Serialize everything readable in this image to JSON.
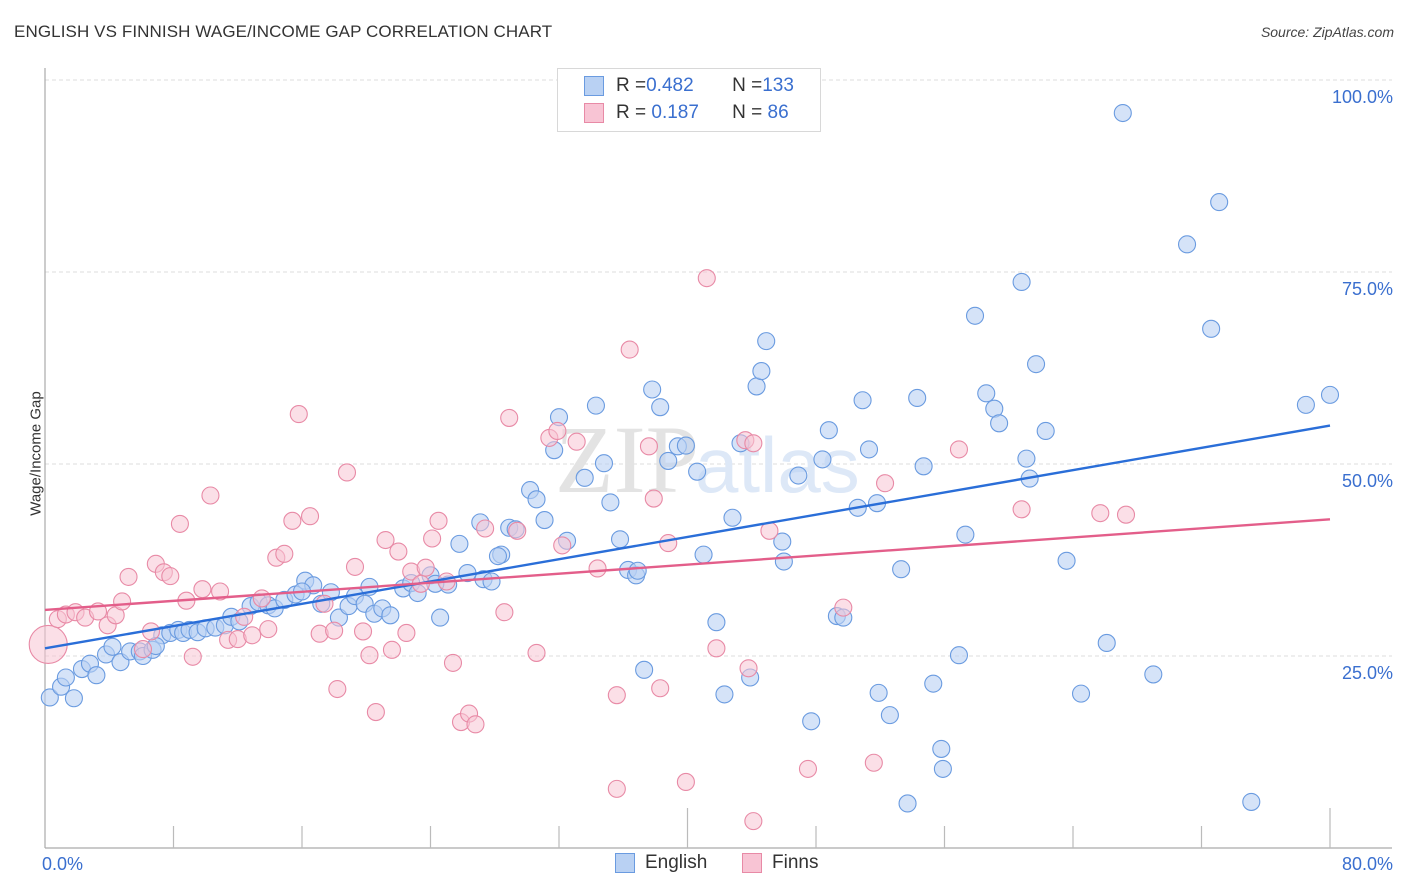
{
  "title": "ENGLISH VS FINNISH WAGE/INCOME GAP CORRELATION CHART",
  "source": "Source: ZipAtlas.com",
  "watermark": {
    "zip": "ZIP",
    "atlas": "atlas"
  },
  "legend": {
    "rows": [
      {
        "r_label": "R = ",
        "r_value": "0.482",
        "n_label": "N = ",
        "n_value": "133"
      },
      {
        "r_label": "R = ",
        "r_value": " 0.187",
        "n_label": "N = ",
        "n_value": " 86"
      }
    ]
  },
  "chart_data": {
    "type": "scatter",
    "title": "ENGLISH VS FINNISH WAGE/INCOME GAP CORRELATION CHART",
    "xlabel": "",
    "ylabel": "Wage/Income Gap",
    "xlim": [
      0,
      80
    ],
    "ylim": [
      0,
      100
    ],
    "x_ticks": [
      "0.0%",
      "80.0%"
    ],
    "y_ticks": [
      "25.0%",
      "50.0%",
      "75.0%",
      "100.0%"
    ],
    "grid": true,
    "legend_position": "bottom-center",
    "series": [
      {
        "name": "English",
        "color": "#6a9be0",
        "fill": "#b9d1f3",
        "R": 0.482,
        "N": 133,
        "trend": {
          "x": [
            0,
            80
          ],
          "y": [
            26.0,
            55.0
          ],
          "color": "#2a6ed8"
        },
        "points": [
          [
            0.3,
            19.6
          ],
          [
            1.0,
            21.0
          ],
          [
            1.3,
            22.2
          ],
          [
            1.8,
            19.5
          ],
          [
            2.3,
            23.3
          ],
          [
            2.8,
            24.0
          ],
          [
            3.2,
            22.5
          ],
          [
            3.8,
            25.2
          ],
          [
            4.2,
            26.2
          ],
          [
            4.7,
            24.2
          ],
          [
            5.3,
            25.6
          ],
          [
            5.9,
            25.6
          ],
          [
            6.1,
            25.0
          ],
          [
            6.7,
            25.8
          ],
          [
            7.3,
            27.7
          ],
          [
            7.8,
            28.0
          ],
          [
            8.3,
            28.4
          ],
          [
            8.6,
            28.0
          ],
          [
            9.0,
            28.4
          ],
          [
            9.5,
            28.1
          ],
          [
            10.0,
            28.6
          ],
          [
            10.6,
            28.7
          ],
          [
            11.2,
            29.0
          ],
          [
            11.6,
            30.1
          ],
          [
            12.1,
            29.5
          ],
          [
            12.8,
            31.5
          ],
          [
            13.3,
            32.0
          ],
          [
            13.9,
            31.6
          ],
          [
            14.3,
            31.2
          ],
          [
            14.9,
            32.3
          ],
          [
            15.6,
            33.0
          ],
          [
            16.2,
            34.8
          ],
          [
            16.7,
            34.2
          ],
          [
            17.2,
            31.8
          ],
          [
            17.8,
            33.3
          ],
          [
            18.3,
            30.0
          ],
          [
            18.9,
            31.5
          ],
          [
            19.3,
            32.8
          ],
          [
            19.9,
            31.8
          ],
          [
            20.5,
            30.5
          ],
          [
            21.0,
            31.2
          ],
          [
            21.5,
            30.3
          ],
          [
            22.3,
            33.8
          ],
          [
            22.8,
            34.5
          ],
          [
            23.2,
            33.2
          ],
          [
            24.0,
            35.5
          ],
          [
            24.6,
            30.0
          ],
          [
            25.1,
            34.3
          ],
          [
            25.8,
            39.6
          ],
          [
            26.3,
            35.8
          ],
          [
            27.1,
            42.4
          ],
          [
            27.3,
            35.0
          ],
          [
            27.8,
            34.7
          ],
          [
            28.4,
            38.2
          ],
          [
            28.9,
            41.7
          ],
          [
            29.3,
            41.5
          ],
          [
            30.2,
            46.6
          ],
          [
            30.6,
            45.4
          ],
          [
            31.1,
            42.7
          ],
          [
            31.7,
            51.8
          ],
          [
            32.0,
            56.1
          ],
          [
            32.5,
            40.0
          ],
          [
            33.6,
            48.2
          ],
          [
            34.3,
            57.6
          ],
          [
            34.8,
            50.1
          ],
          [
            35.2,
            45.0
          ],
          [
            35.8,
            40.2
          ],
          [
            36.3,
            36.2
          ],
          [
            36.8,
            35.5
          ],
          [
            37.3,
            23.2
          ],
          [
            37.8,
            59.7
          ],
          [
            38.3,
            57.4
          ],
          [
            38.8,
            50.4
          ],
          [
            39.4,
            52.3
          ],
          [
            39.9,
            52.4
          ],
          [
            40.6,
            49.0
          ],
          [
            41.0,
            38.2
          ],
          [
            41.8,
            29.4
          ],
          [
            42.3,
            20.0
          ],
          [
            42.8,
            43.0
          ],
          [
            43.3,
            52.7
          ],
          [
            43.9,
            22.2
          ],
          [
            44.3,
            60.1
          ],
          [
            44.6,
            62.1
          ],
          [
            44.9,
            66.0
          ],
          [
            45.9,
            39.9
          ],
          [
            46.0,
            37.3
          ],
          [
            46.9,
            48.5
          ],
          [
            47.7,
            16.5
          ],
          [
            48.4,
            50.6
          ],
          [
            48.8,
            54.4
          ],
          [
            49.3,
            30.2
          ],
          [
            49.7,
            30.0
          ],
          [
            50.6,
            44.3
          ],
          [
            50.9,
            58.3
          ],
          [
            51.3,
            51.9
          ],
          [
            51.8,
            44.9
          ],
          [
            51.9,
            20.2
          ],
          [
            52.6,
            17.3
          ],
          [
            53.3,
            36.3
          ],
          [
            53.7,
            5.8
          ],
          [
            54.3,
            58.6
          ],
          [
            54.7,
            49.7
          ],
          [
            55.3,
            21.4
          ],
          [
            55.8,
            12.9
          ],
          [
            55.9,
            10.3
          ],
          [
            56.9,
            25.1
          ],
          [
            57.3,
            40.8
          ],
          [
            57.9,
            69.3
          ],
          [
            58.6,
            59.2
          ],
          [
            59.1,
            57.2
          ],
          [
            59.4,
            55.3
          ],
          [
            60.8,
            73.7
          ],
          [
            61.3,
            48.1
          ],
          [
            61.1,
            50.7
          ],
          [
            61.7,
            63.0
          ],
          [
            62.3,
            54.3
          ],
          [
            63.6,
            37.4
          ],
          [
            64.5,
            20.1
          ],
          [
            66.1,
            26.7
          ],
          [
            67.1,
            95.7
          ],
          [
            69.0,
            22.6
          ],
          [
            71.1,
            78.6
          ],
          [
            72.6,
            67.6
          ],
          [
            73.1,
            84.1
          ],
          [
            75.1,
            6.0
          ],
          [
            78.5,
            57.7
          ],
          [
            80.0,
            59.0
          ],
          [
            28.2,
            38.0
          ],
          [
            6.9,
            26.3
          ],
          [
            16.0,
            33.4
          ],
          [
            20.2,
            34.0
          ],
          [
            24.3,
            34.4
          ],
          [
            36.9,
            36.1
          ]
        ]
      },
      {
        "name": "Finns",
        "color": "#e88aa6",
        "fill": "#f8c4d4",
        "R": 0.187,
        "N": 86,
        "trend": {
          "x": [
            0,
            80
          ],
          "y": [
            31.0,
            42.8
          ],
          "color": "#e35e8a"
        },
        "points": [
          [
            0.2,
            26.5
          ],
          [
            0.8,
            29.8
          ],
          [
            1.3,
            30.4
          ],
          [
            1.9,
            30.7
          ],
          [
            2.5,
            30.0
          ],
          [
            3.3,
            30.8
          ],
          [
            3.9,
            29.0
          ],
          [
            4.4,
            30.3
          ],
          [
            4.8,
            32.1
          ],
          [
            5.2,
            35.3
          ],
          [
            6.1,
            25.9
          ],
          [
            6.6,
            28.2
          ],
          [
            6.9,
            37.0
          ],
          [
            7.4,
            35.9
          ],
          [
            7.8,
            35.4
          ],
          [
            8.4,
            42.2
          ],
          [
            8.8,
            32.2
          ],
          [
            9.2,
            24.9
          ],
          [
            9.8,
            33.7
          ],
          [
            10.3,
            45.9
          ],
          [
            10.9,
            33.4
          ],
          [
            11.4,
            27.1
          ],
          [
            12.0,
            27.2
          ],
          [
            12.4,
            30.1
          ],
          [
            12.9,
            27.7
          ],
          [
            13.5,
            32.5
          ],
          [
            13.9,
            28.5
          ],
          [
            14.4,
            37.8
          ],
          [
            14.9,
            38.3
          ],
          [
            15.4,
            42.6
          ],
          [
            15.8,
            56.5
          ],
          [
            16.5,
            43.2
          ],
          [
            17.1,
            27.9
          ],
          [
            17.4,
            31.8
          ],
          [
            18.0,
            28.3
          ],
          [
            18.2,
            20.7
          ],
          [
            18.8,
            48.9
          ],
          [
            19.3,
            36.6
          ],
          [
            19.8,
            28.2
          ],
          [
            20.2,
            25.1
          ],
          [
            20.6,
            17.7
          ],
          [
            21.2,
            40.1
          ],
          [
            21.6,
            25.8
          ],
          [
            22.0,
            38.6
          ],
          [
            22.5,
            28.0
          ],
          [
            22.8,
            36.0
          ],
          [
            23.4,
            34.4
          ],
          [
            23.7,
            36.5
          ],
          [
            24.1,
            40.3
          ],
          [
            24.5,
            42.6
          ],
          [
            25.0,
            34.7
          ],
          [
            25.4,
            24.1
          ],
          [
            25.9,
            16.4
          ],
          [
            26.4,
            17.5
          ],
          [
            26.8,
            16.1
          ],
          [
            27.4,
            41.6
          ],
          [
            28.6,
            30.7
          ],
          [
            28.9,
            56.0
          ],
          [
            29.4,
            41.3
          ],
          [
            30.6,
            25.4
          ],
          [
            31.4,
            53.4
          ],
          [
            31.9,
            54.3
          ],
          [
            32.2,
            39.4
          ],
          [
            33.1,
            52.9
          ],
          [
            34.4,
            36.4
          ],
          [
            35.6,
            19.9
          ],
          [
            35.6,
            7.7
          ],
          [
            36.4,
            64.9
          ],
          [
            37.6,
            52.3
          ],
          [
            37.9,
            45.5
          ],
          [
            38.3,
            20.8
          ],
          [
            38.8,
            39.7
          ],
          [
            39.9,
            8.6
          ],
          [
            41.2,
            74.2
          ],
          [
            41.8,
            26.0
          ],
          [
            43.8,
            23.4
          ],
          [
            43.6,
            53.1
          ],
          [
            44.1,
            52.7
          ],
          [
            44.1,
            3.5
          ],
          [
            45.1,
            41.3
          ],
          [
            47.5,
            10.3
          ],
          [
            49.7,
            31.3
          ],
          [
            51.6,
            11.1
          ],
          [
            52.3,
            47.5
          ],
          [
            56.9,
            51.9
          ],
          [
            60.8,
            44.1
          ],
          [
            65.7,
            43.6
          ],
          [
            67.3,
            43.4
          ]
        ]
      }
    ]
  },
  "bottom_legend": [
    {
      "label": "English"
    },
    {
      "label": "Finns"
    }
  ]
}
